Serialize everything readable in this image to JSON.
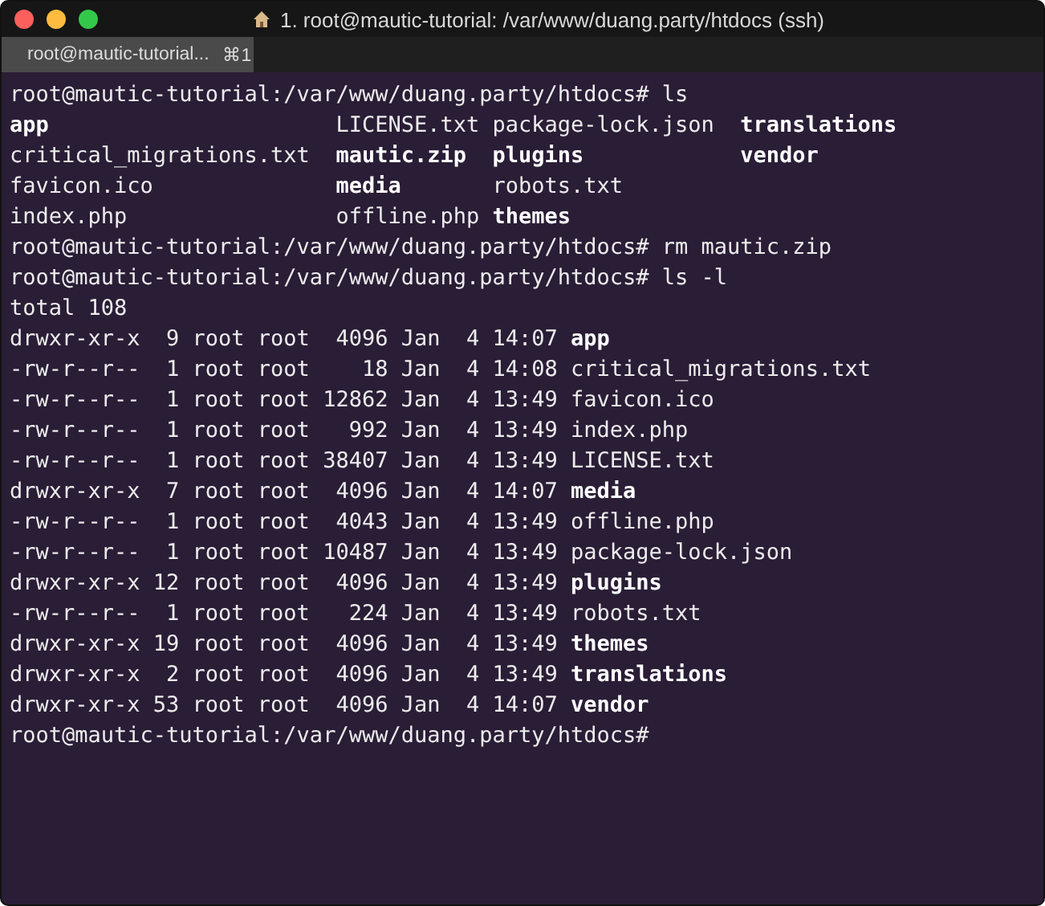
{
  "window": {
    "title": "1. root@mautic-tutorial: /var/www/duang.party/htdocs (ssh)"
  },
  "tabs": [
    {
      "label": "root@mautic-tutorial...",
      "shortcut": "⌘1",
      "selected": true
    }
  ],
  "terminal": {
    "lines": [
      {
        "kind": "prompt",
        "prompt": "root@mautic-tutorial:/var/www/duang.party/htdocs#",
        "command": "ls"
      },
      {
        "kind": "grid",
        "entries": [
          {
            "name": "app",
            "bold": true
          },
          {
            "name": "LICENSE.txt",
            "bold": false
          },
          {
            "name": "package-lock.json",
            "bold": false
          },
          {
            "name": "translations",
            "bold": true
          }
        ]
      },
      {
        "kind": "grid",
        "entries": [
          {
            "name": "critical_migrations.txt",
            "bold": false
          },
          {
            "name": "mautic.zip",
            "bold": true
          },
          {
            "name": "plugins",
            "bold": true
          },
          {
            "name": "vendor",
            "bold": true
          }
        ]
      },
      {
        "kind": "grid",
        "entries": [
          {
            "name": "favicon.ico",
            "bold": false
          },
          {
            "name": "media",
            "bold": true
          },
          {
            "name": "robots.txt",
            "bold": false
          }
        ]
      },
      {
        "kind": "grid",
        "entries": [
          {
            "name": "index.php",
            "bold": false
          },
          {
            "name": "offline.php",
            "bold": false
          },
          {
            "name": "themes",
            "bold": true
          }
        ]
      },
      {
        "kind": "prompt",
        "prompt": "root@mautic-tutorial:/var/www/duang.party/htdocs#",
        "command": "rm mautic.zip"
      },
      {
        "kind": "prompt",
        "prompt": "root@mautic-tutorial:/var/www/duang.party/htdocs#",
        "command": "ls -l"
      },
      {
        "kind": "text",
        "text": "total 108"
      },
      {
        "kind": "long",
        "meta": "drwxr-xr-x  9 root root  4096 Jan  4 14:07",
        "name": "app",
        "bold": true
      },
      {
        "kind": "long",
        "meta": "-rw-r--r--  1 root root    18 Jan  4 14:08",
        "name": "critical_migrations.txt",
        "bold": false
      },
      {
        "kind": "long",
        "meta": "-rw-r--r--  1 root root 12862 Jan  4 13:49",
        "name": "favicon.ico",
        "bold": false
      },
      {
        "kind": "long",
        "meta": "-rw-r--r--  1 root root   992 Jan  4 13:49",
        "name": "index.php",
        "bold": false
      },
      {
        "kind": "long",
        "meta": "-rw-r--r--  1 root root 38407 Jan  4 13:49",
        "name": "LICENSE.txt",
        "bold": false
      },
      {
        "kind": "long",
        "meta": "drwxr-xr-x  7 root root  4096 Jan  4 14:07",
        "name": "media",
        "bold": true
      },
      {
        "kind": "long",
        "meta": "-rw-r--r--  1 root root  4043 Jan  4 13:49",
        "name": "offline.php",
        "bold": false
      },
      {
        "kind": "long",
        "meta": "-rw-r--r--  1 root root 10487 Jan  4 13:49",
        "name": "package-lock.json",
        "bold": false
      },
      {
        "kind": "long",
        "meta": "drwxr-xr-x 12 root root  4096 Jan  4 13:49",
        "name": "plugins",
        "bold": true
      },
      {
        "kind": "long",
        "meta": "-rw-r--r--  1 root root   224 Jan  4 13:49",
        "name": "robots.txt",
        "bold": false
      },
      {
        "kind": "long",
        "meta": "drwxr-xr-x 19 root root  4096 Jan  4 13:49",
        "name": "themes",
        "bold": true
      },
      {
        "kind": "long",
        "meta": "drwxr-xr-x  2 root root  4096 Jan  4 13:49",
        "name": "translations",
        "bold": true
      },
      {
        "kind": "long",
        "meta": "drwxr-xr-x 53 root root  4096 Jan  4 14:07",
        "name": "vendor",
        "bold": true
      },
      {
        "kind": "prompt",
        "prompt": "root@mautic-tutorial:/var/www/duang.party/htdocs#"
      }
    ]
  }
}
